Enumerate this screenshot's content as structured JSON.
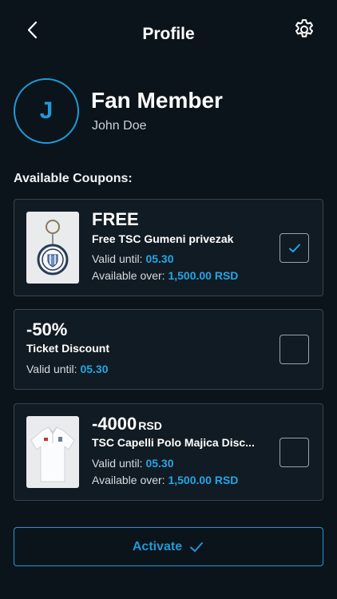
{
  "header": {
    "title": "Profile"
  },
  "profile": {
    "avatar_initial": "J",
    "member_title": "Fan Member",
    "name": "John Doe"
  },
  "coupons": {
    "section_title": "Available Coupons:",
    "valid_label": "Valid until:",
    "available_label": "Available over:",
    "items": [
      {
        "big": "FREE",
        "name": "Free TSC Gumeni privezak",
        "valid_until": "05.30",
        "available_over": "1,500.00 RSD",
        "checked": true,
        "thumbnail": "keychain"
      },
      {
        "big": "-50%",
        "name": "Ticket Discount",
        "valid_until": "05.30",
        "checked": false
      },
      {
        "big": "-4000",
        "unit": "RSD",
        "name": "TSC Capelli Polo Majica Disc...",
        "valid_until": "05.30",
        "available_over": "1,500.00 RSD",
        "checked": false,
        "thumbnail": "polo-shirt"
      }
    ]
  },
  "activate": {
    "label": "Activate"
  },
  "colors": {
    "background": "#0b141b",
    "accent": "#1f9ad6",
    "card": "#111b23",
    "border": "#3a434b"
  }
}
